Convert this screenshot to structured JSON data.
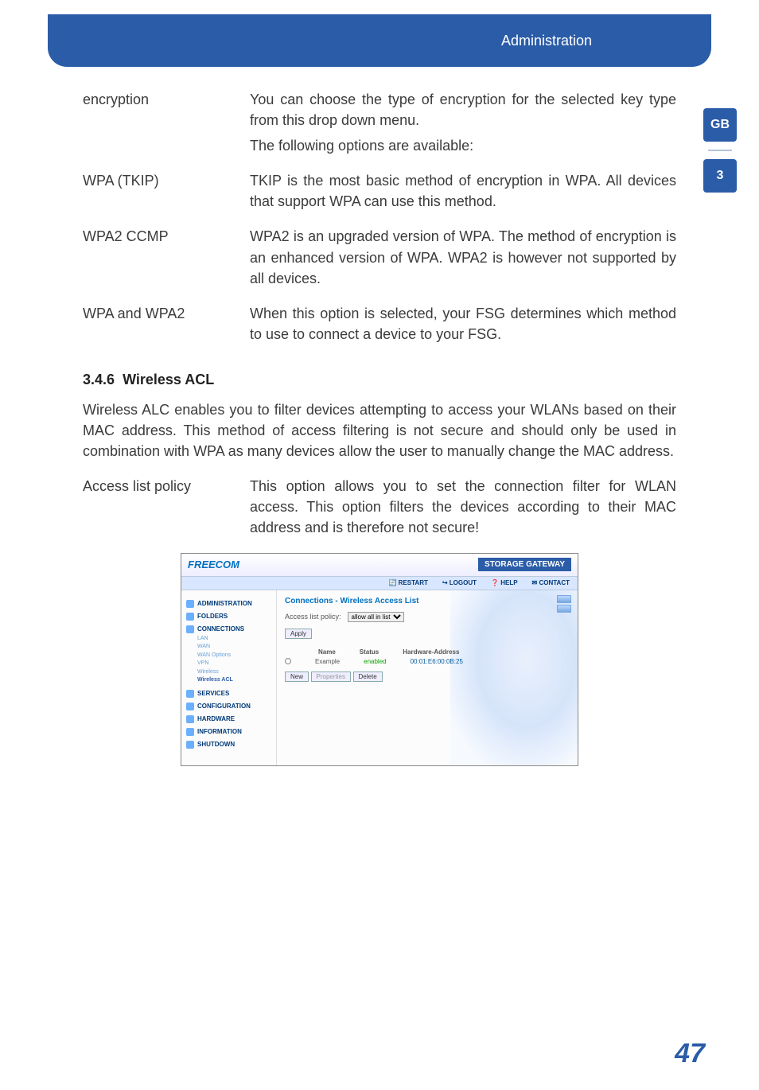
{
  "header": {
    "breadcrumb": "Administration"
  },
  "sidetabs": {
    "lang": "GB",
    "chapter": "3"
  },
  "definitions": [
    {
      "term": "encryption",
      "paras": [
        "You can choose the type of encryption for the selected key type from this drop down menu.",
        "The following options are available:"
      ]
    },
    {
      "term": "WPA (TKIP)",
      "paras": [
        "TKIP is the most basic method of encryption in WPA. All devices that support WPA can use this method."
      ]
    },
    {
      "term": "WPA2 CCMP",
      "paras": [
        "WPA2 is an upgraded version of WPA. The method of encryption is an enhanced version of WPA. WPA2 is however not supported by all devices."
      ]
    },
    {
      "term": "WPA and WPA2",
      "paras": [
        "When this option is selected, your FSG determines which method to use to connect a device to your FSG."
      ]
    }
  ],
  "section": {
    "number": "3.4.6",
    "title": "Wireless ACL"
  },
  "intro": "Wireless ALC enables you to filter devices attempting to access your WLANs based on their MAC address. This method of access filtering is not secure and should only be used in combination with WPA as many devices allow the user to manually change the MAC address.",
  "definitions2": [
    {
      "term": "Access list policy",
      "paras": [
        "This option allows you to set the connection filter for WLAN access. This option filters the devices according to their MAC address and is therefore not secure!"
      ]
    }
  ],
  "screenshot": {
    "logo": "FREECOM",
    "brand": "STORAGE GATEWAY",
    "toolbar": [
      "RESTART",
      "LOGOUT",
      "HELP",
      "CONTACT"
    ],
    "nav": {
      "sections": [
        "ADMINISTRATION",
        "FOLDERS",
        "CONNECTIONS",
        "SERVICES",
        "CONFIGURATION",
        "HARDWARE",
        "INFORMATION",
        "SHUTDOWN"
      ],
      "conn_items": [
        "LAN",
        "WAN",
        "WAN Options",
        "VPN",
        "Wireless",
        "Wireless ACL"
      ]
    },
    "panel": {
      "title": "Connections - Wireless Access List",
      "policy_label": "Access list policy:",
      "policy_value": "allow all in list",
      "apply": "Apply",
      "headers": [
        "Name",
        "Status",
        "Hardware-Address"
      ],
      "row": {
        "name": "Example",
        "status": "enabled",
        "mac": "00:01:E6:00:0B:25"
      },
      "buttons": [
        "New",
        "Properties",
        "Delete"
      ]
    }
  },
  "pagenum": "47"
}
